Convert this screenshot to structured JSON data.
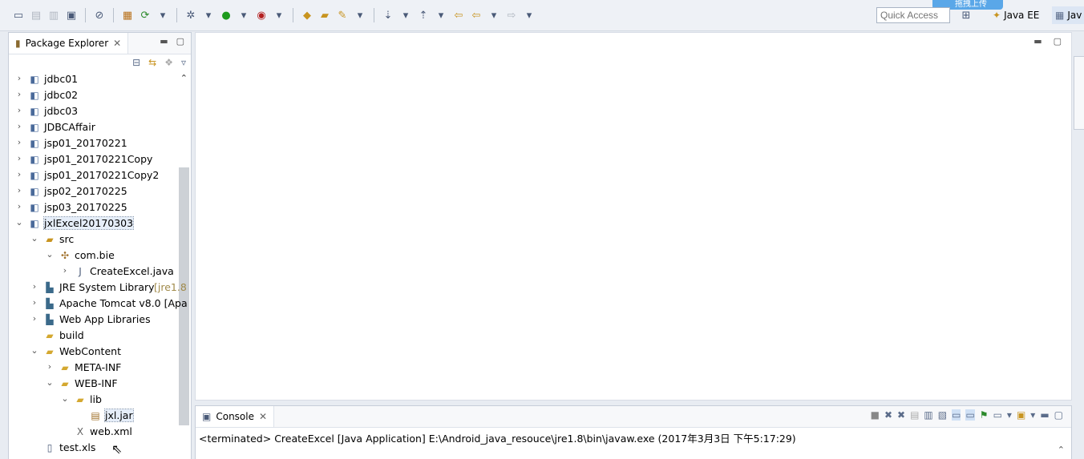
{
  "toolbar": {
    "quick_access_placeholder": "Quick Access",
    "perspectives": [
      {
        "label": "Java EE"
      },
      {
        "label": "Jav"
      }
    ],
    "upload_tip": "拖拽上传"
  },
  "package_explorer": {
    "title": "Package Explorer",
    "tree": [
      {
        "label": "jdbc01",
        "type": "project",
        "expanded": false,
        "depth": 0
      },
      {
        "label": "jdbc02",
        "type": "project",
        "expanded": false,
        "depth": 0
      },
      {
        "label": "jdbc03",
        "type": "project",
        "expanded": false,
        "depth": 0
      },
      {
        "label": "JDBCAffair",
        "type": "web-project",
        "expanded": false,
        "depth": 0
      },
      {
        "label": "jsp01_20170221",
        "type": "web-project",
        "expanded": false,
        "depth": 0
      },
      {
        "label": "jsp01_20170221Copy",
        "type": "web-project",
        "expanded": false,
        "depth": 0
      },
      {
        "label": "jsp01_20170221Copy2",
        "type": "web-project",
        "expanded": false,
        "depth": 0
      },
      {
        "label": "jsp02_20170225",
        "type": "web-project",
        "expanded": false,
        "depth": 0
      },
      {
        "label": "jsp03_20170225",
        "type": "web-project",
        "expanded": false,
        "depth": 0
      },
      {
        "label": "jxlExcel20170303",
        "type": "web-project",
        "expanded": true,
        "depth": 0,
        "selected": true
      },
      {
        "label": "src",
        "type": "src-folder",
        "expanded": true,
        "depth": 1
      },
      {
        "label": "com.bie",
        "type": "package",
        "expanded": true,
        "depth": 2
      },
      {
        "label": "CreateExcel.java",
        "type": "java-file",
        "expanded": false,
        "depth": 3
      },
      {
        "label": "JRE System Library",
        "suffix": "[jre1.8",
        "type": "library",
        "expanded": false,
        "depth": 1
      },
      {
        "label": "Apache Tomcat v8.0 [Apa",
        "type": "library",
        "expanded": false,
        "depth": 1
      },
      {
        "label": "Web App Libraries",
        "type": "library",
        "expanded": false,
        "depth": 1
      },
      {
        "label": "build",
        "type": "folder",
        "expanded": null,
        "depth": 1
      },
      {
        "label": "WebContent",
        "type": "folder",
        "expanded": true,
        "depth": 1
      },
      {
        "label": "META-INF",
        "type": "folder",
        "expanded": false,
        "depth": 2
      },
      {
        "label": "WEB-INF",
        "type": "folder",
        "expanded": true,
        "depth": 2
      },
      {
        "label": "lib",
        "type": "folder",
        "expanded": true,
        "depth": 3
      },
      {
        "label": "jxl.jar",
        "type": "jar-file",
        "expanded": null,
        "depth": 4,
        "selected": true
      },
      {
        "label": "web.xml",
        "type": "xml-file",
        "expanded": null,
        "depth": 3
      },
      {
        "label": "test.xls",
        "type": "file",
        "expanded": null,
        "depth": 1
      }
    ]
  },
  "console": {
    "title": "Console",
    "output": "<terminated> CreateExcel [Java Application] E:\\Android_java_resouce\\jre1.8\\bin\\javaw.exe (2017年3月3日 下午5:17:29)"
  }
}
